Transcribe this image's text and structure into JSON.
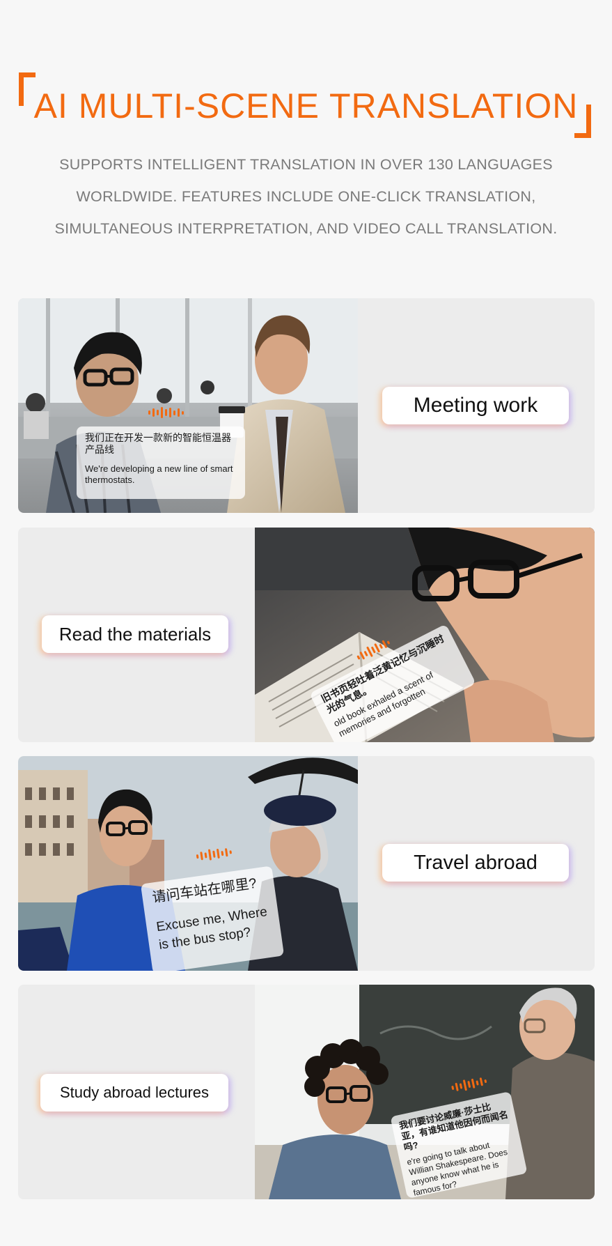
{
  "hero": {
    "title": "AI MULTI-SCENE TRANSLATION",
    "subtitle_lines": [
      "SUPPORTS INTELLIGENT TRANSLATION IN OVER 130 LANGUAGES",
      "WORLDWIDE. FEATURES INCLUDE ONE-CLICK TRANSLATION,",
      "SIMULTANEOUS INTERPRETATION, AND VIDEO CALL TRANSLATION."
    ],
    "accent_color": "#f26a11"
  },
  "scenes": [
    {
      "label": "Meeting work",
      "source_text": "我们正在开发一款新的智能恒温器产品线",
      "translated_text": "We're developing a new line of smart thermostats."
    },
    {
      "label": "Read the materials",
      "source_text": "旧书页轻吐着泛黄记忆与沉睡时光的气息。",
      "translated_text": "old book exhaled a scent of memories and forgotten"
    },
    {
      "label": "Travel abroad",
      "source_text": "请问车站在哪里?",
      "translated_text": "Excuse me, Where is the bus stop?"
    },
    {
      "label": "Study abroad lectures",
      "source_text": "我们要讨论威廉·莎士比亚，有谁知道他因何而闻名吗?",
      "translated_text": "e're going to talk about Willian Shakespeare. Does anyone know what he is famous for?"
    }
  ]
}
